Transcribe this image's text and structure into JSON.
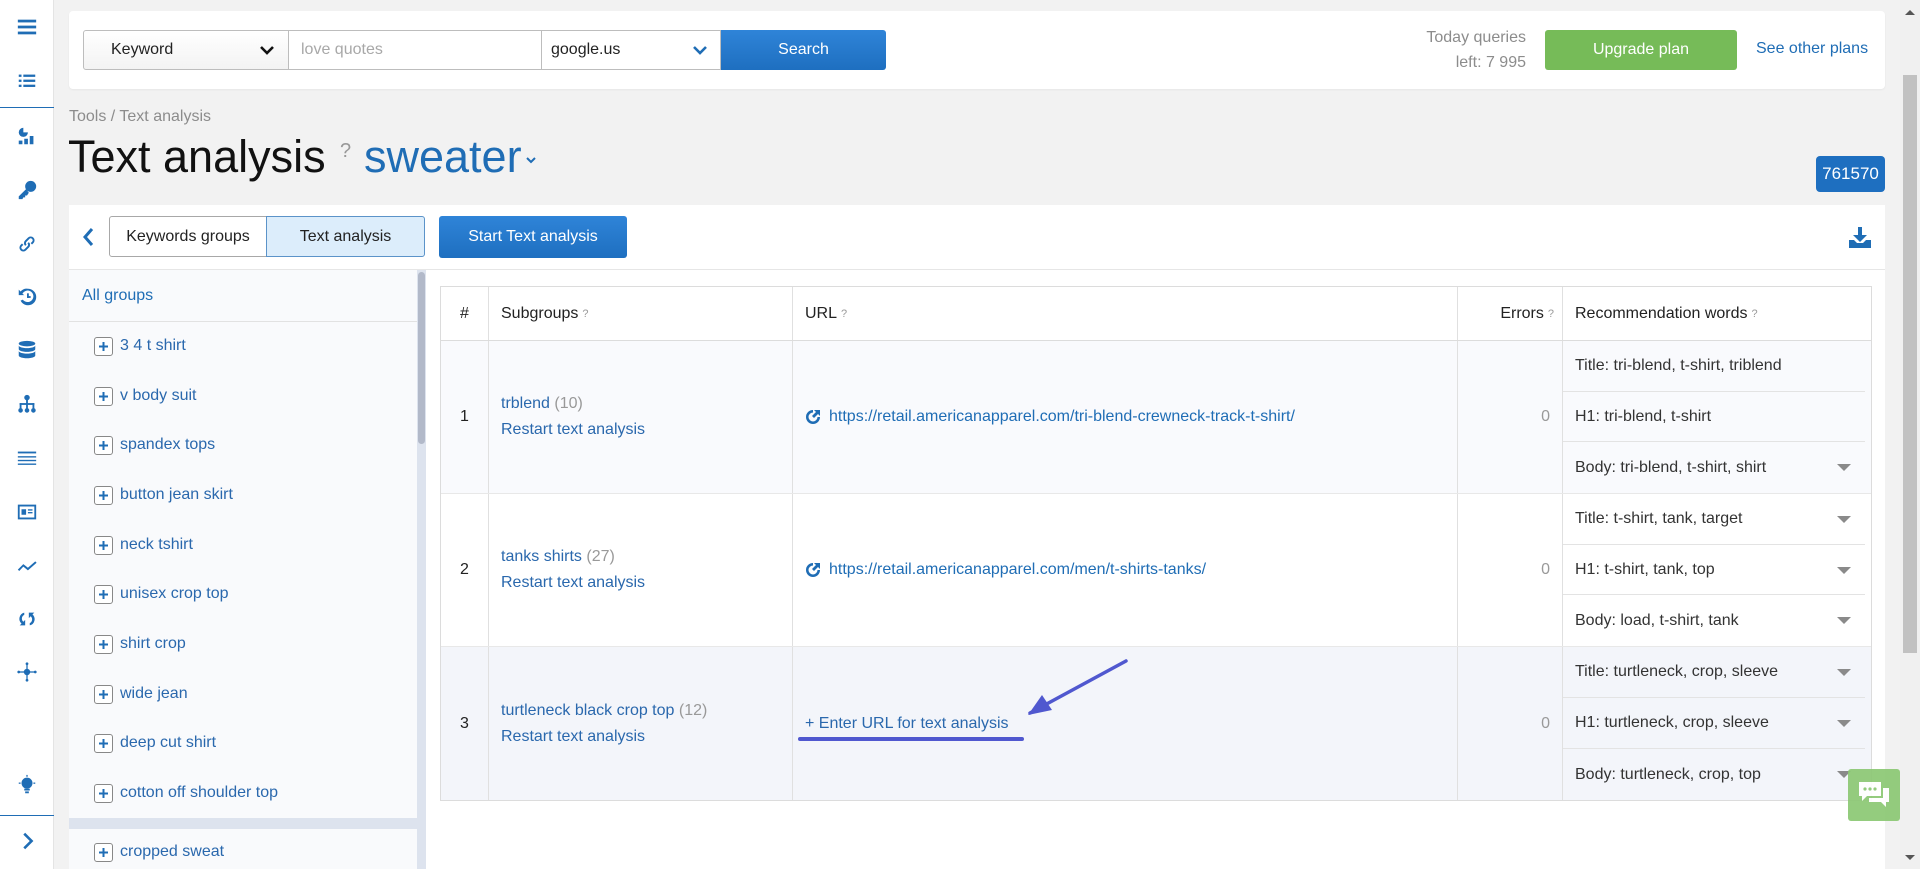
{
  "left_nav": {
    "icons": [
      "menu-icon",
      "list-icon",
      "dashboard-icon",
      "key-icon",
      "link-icon",
      "history-icon",
      "database-icon",
      "sitemap-icon",
      "table-icon",
      "card-icon",
      "trend-icon",
      "sync-icon",
      "network-icon",
      "lightbulb-icon",
      "expand-icon"
    ]
  },
  "search_bar": {
    "type_select": "Keyword",
    "query_placeholder": "love quotes",
    "query_value": "",
    "engine_select": "google.us",
    "search_label": "Search"
  },
  "account": {
    "queries_line1": "Today queries",
    "queries_line2": "left: 7 995",
    "upgrade_label": "Upgrade plan",
    "other_plans_label": "See other plans"
  },
  "breadcrumb": "Tools / Text analysis",
  "page_title": "Text analysis",
  "title_help": "?",
  "project_name": "sweater",
  "project_id": "761570",
  "toolbar": {
    "tab_keywords_groups": "Keywords groups",
    "tab_text_analysis": "Text analysis",
    "start_label": "Start Text analysis"
  },
  "groups": {
    "all_label": "All groups",
    "items": [
      "3 4 t shirt",
      "v body suit",
      "spandex tops",
      "button jean skirt",
      "neck tshirt",
      "unisex crop top",
      "shirt crop",
      "wide jean",
      "deep cut shirt",
      "cotton off shoulder top",
      "cropped sweat"
    ]
  },
  "table": {
    "headers": {
      "num": "#",
      "subgroups": "Subgroups",
      "url": "URL",
      "errors": "Errors",
      "recommendations": "Recommendation words",
      "help": "?"
    },
    "rows": [
      {
        "num": "1",
        "name": "trblend",
        "count": "(10)",
        "restart": "Restart text analysis",
        "url": "https://retail.americanapparel.com/tri-blend-crewneck-track-t-shirt/",
        "errors": "0",
        "recs": [
          "Title: tri-blend, t-shirt, triblend",
          "H1: tri-blend, t-shirt",
          "Body: tri-blend, t-shirt, shirt"
        ]
      },
      {
        "num": "2",
        "name": "tanks shirts",
        "count": "(27)",
        "restart": "Restart text analysis",
        "url": "https://retail.americanapparel.com/men/t-shirts-tanks/",
        "errors": "0",
        "recs": [
          "Title: t-shirt, tank, target",
          "H1: t-shirt, tank, top",
          "Body: load, t-shirt, tank"
        ]
      },
      {
        "num": "3",
        "name": "turtleneck black crop top",
        "count": "(12)",
        "restart": "Restart text analysis",
        "enter_url": "+ Enter URL for text analysis",
        "errors": "0",
        "recs": [
          "Title: turtleneck, crop, sleeve",
          "H1: turtleneck, crop, sleeve",
          "Body: turtleneck, crop, top"
        ]
      }
    ]
  },
  "colors": {
    "brand_blue": "#1e6fc0",
    "upgrade_green": "#76bb58",
    "annotation": "#5058cf"
  }
}
